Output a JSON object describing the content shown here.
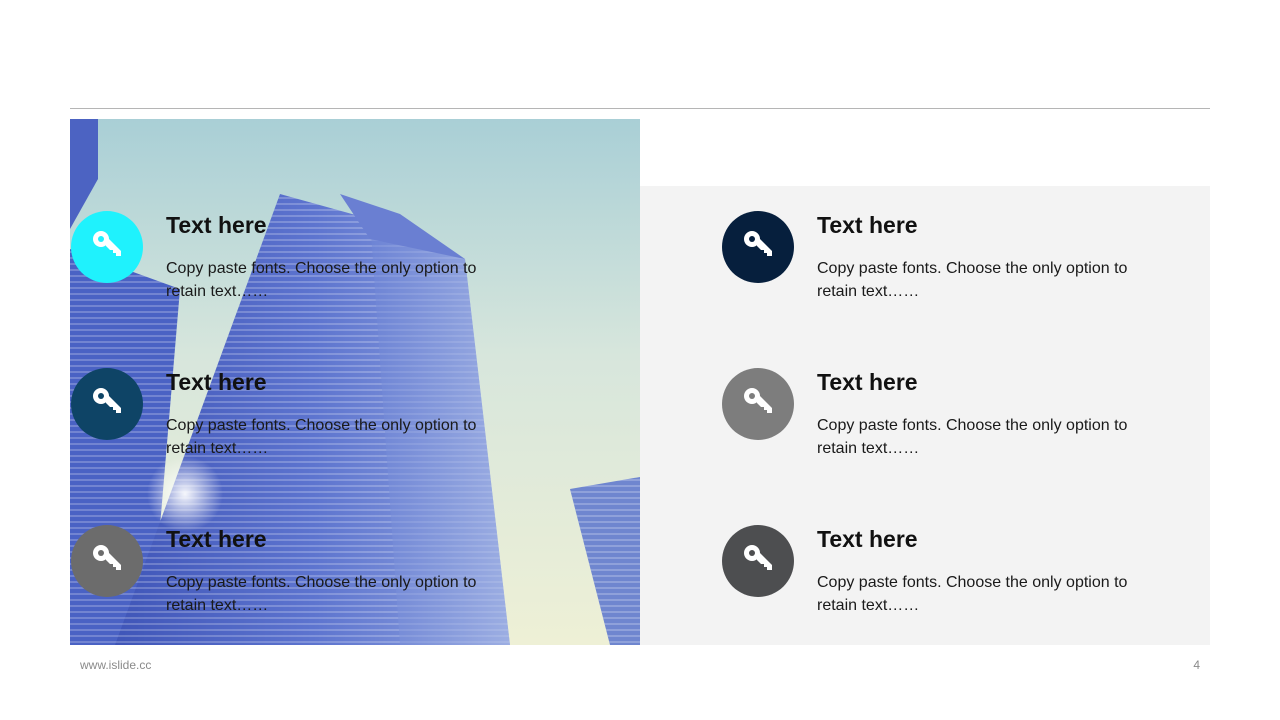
{
  "features": [
    {
      "title": "Text here",
      "text": "Copy paste fonts. Choose the only option to retain text……",
      "color": "#1ff2fd",
      "icon": "key-icon"
    },
    {
      "title": "Text here",
      "text": "Copy paste fonts. Choose the only option to retain text……",
      "color": "#0e4466",
      "icon": "key-icon"
    },
    {
      "title": "Text here",
      "text": "Copy paste fonts. Choose the only option to retain text……",
      "color": "#6c6c6c",
      "icon": "key-icon"
    },
    {
      "title": "Text here",
      "text": "Copy paste fonts. Choose the only option to retain text……",
      "color": "#061f3d",
      "icon": "key-icon"
    },
    {
      "title": "Text here",
      "text": "Copy paste fonts. Choose the only option to retain text……",
      "color": "#7d7d7d",
      "icon": "key-icon"
    },
    {
      "title": "Text here",
      "text": "Copy paste fonts. Choose the only option to retain text……",
      "color": "#4d4e50",
      "icon": "key-icon"
    }
  ],
  "footer": {
    "url": "www.islide.cc",
    "page_number": "4"
  },
  "colors": {
    "divider": "#b5b5b5",
    "panel_background": "#f3f3f3"
  }
}
